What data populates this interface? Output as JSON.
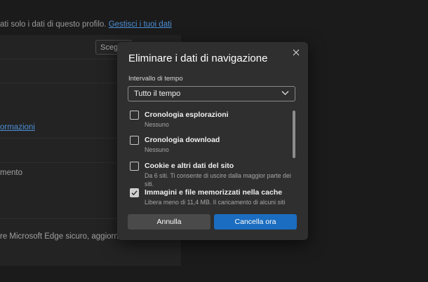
{
  "background": {
    "top_text": "ati solo i dati di questo profilo.",
    "top_link": "Gestisci i tuoi dati",
    "select_label": "Scegli",
    "link_partial": "ormazioni",
    "label_1": "mento",
    "label_2": "re Microsoft Edge sicuro, aggiornato"
  },
  "dialog": {
    "title": "Eliminare i dati di navigazione",
    "close_icon": "close-icon",
    "range_label": "Intervallo di tempo",
    "range_value": "Tutto il tempo",
    "items": [
      {
        "title": "Cronologia esplorazioni",
        "desc": "Nessuno",
        "checked": false
      },
      {
        "title": "Cronologia download",
        "desc": "Nessuno",
        "checked": false
      },
      {
        "title": "Cookie e altri dati del sito",
        "desc": "Da 6 siti. Ti consente di uscire dalla maggior parte dei siti.",
        "checked": false
      },
      {
        "title": "Immagini e file memorizzati nella cache",
        "desc": "Libera meno di 11,4 MB. Il caricamento di alcuni siti",
        "checked": true
      }
    ],
    "cancel_label": "Annulla",
    "clear_label": "Cancella ora"
  },
  "colors": {
    "accent": "#1a6dc0",
    "link": "#4d8fd6"
  }
}
